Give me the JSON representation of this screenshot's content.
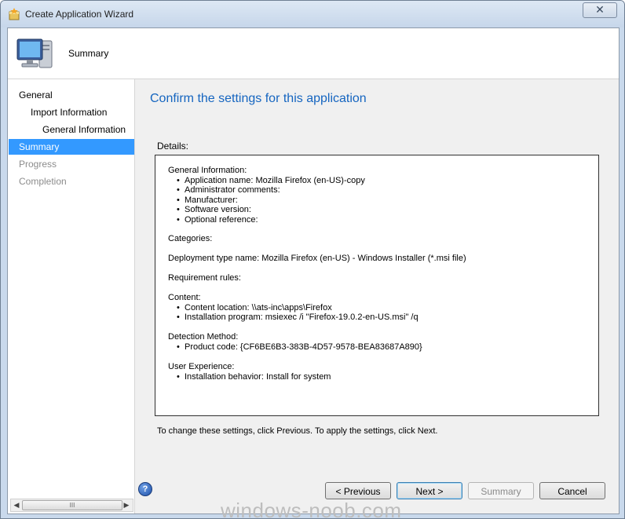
{
  "window": {
    "title": "Create Application Wizard",
    "close_glyph": "✕"
  },
  "header": {
    "title": "Summary"
  },
  "sidebar": {
    "steps": [
      {
        "label": "General",
        "state": "normal",
        "indent": 0
      },
      {
        "label": "Import Information",
        "state": "normal",
        "indent": 1
      },
      {
        "label": "General Information",
        "state": "normal",
        "indent": 2
      },
      {
        "label": "Summary",
        "state": "active",
        "indent": 0
      },
      {
        "label": "Progress",
        "state": "disabled",
        "indent": 0
      },
      {
        "label": "Completion",
        "state": "disabled",
        "indent": 0
      }
    ],
    "scroll_thumb_glyph": "III"
  },
  "main": {
    "title": "Confirm the settings for this application",
    "details_label": "Details:",
    "details": {
      "general_heading": "General Information:",
      "general_items": [
        "Application name: Mozilla Firefox (en-US)-copy",
        "Administrator comments:",
        "Manufacturer:",
        "Software version:",
        "Optional reference:"
      ],
      "categories": "Categories:",
      "deployment_type": "Deployment type name: Mozilla Firefox (en-US) - Windows Installer (*.msi file)",
      "requirement_rules": "Requirement rules:",
      "content_heading": "Content:",
      "content_items": [
        "Content location: \\\\ats-inc\\apps\\Firefox",
        "Installation program: msiexec /i \"Firefox-19.0.2-en-US.msi\" /q"
      ],
      "detection_heading": "Detection Method:",
      "detection_items": [
        "Product code: {CF6BE6B3-383B-4D57-9578-BEA83687A890}"
      ],
      "ux_heading": "User Experience:",
      "ux_items": [
        "Installation behavior: Install for system"
      ]
    },
    "footer_note": "To change these settings, click Previous. To apply the settings, click Next."
  },
  "buttons": {
    "previous": "< Previous",
    "next": "Next >",
    "summary": "Summary",
    "cancel": "Cancel",
    "help": "?"
  },
  "watermark": "windows-noob.com",
  "colors": {
    "accent": "#3399ff",
    "title_blue": "#1565c0"
  }
}
